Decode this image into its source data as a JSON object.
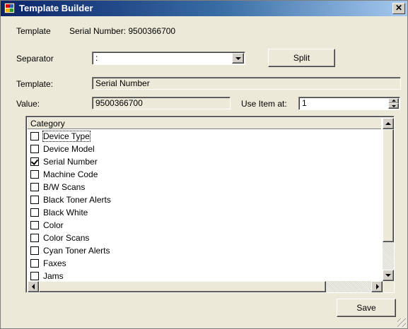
{
  "window": {
    "title": "Template Builder"
  },
  "template_line": {
    "label": "Template",
    "value": "Serial Number: 9500366700"
  },
  "separator": {
    "label": "Separator",
    "value": ":"
  },
  "split_button": "Split",
  "template_field": {
    "label": "Template:",
    "value": "Serial Number"
  },
  "value_field": {
    "label": "Value:",
    "value": "9500366700"
  },
  "use_item": {
    "label": "Use Item at:",
    "value": "1"
  },
  "category_list": {
    "header": "Category",
    "items": [
      {
        "label": "Device Type",
        "checked": false,
        "focused": true
      },
      {
        "label": "Device Model",
        "checked": false
      },
      {
        "label": "Serial Number",
        "checked": true
      },
      {
        "label": "Machine Code",
        "checked": false
      },
      {
        "label": "B/W Scans",
        "checked": false
      },
      {
        "label": "Black Toner Alerts",
        "checked": false
      },
      {
        "label": "Black White",
        "checked": false
      },
      {
        "label": "Color",
        "checked": false
      },
      {
        "label": "Color Scans",
        "checked": false
      },
      {
        "label": "Cyan Toner Alerts",
        "checked": false
      },
      {
        "label": "Faxes",
        "checked": false
      },
      {
        "label": "Jams",
        "checked": false
      }
    ]
  },
  "save_button": "Save"
}
